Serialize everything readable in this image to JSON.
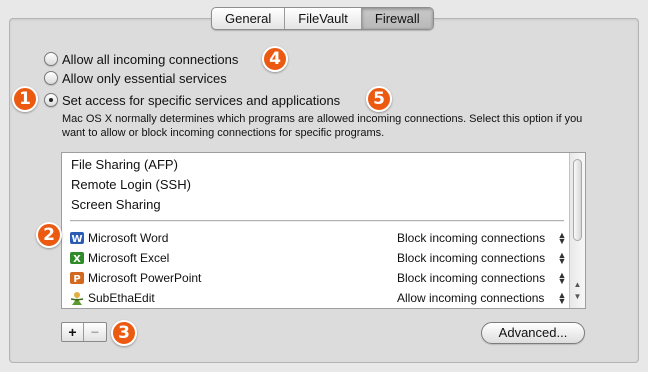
{
  "tabs": [
    {
      "label": "General",
      "selected": false
    },
    {
      "label": "FileVault",
      "selected": false
    },
    {
      "label": "Firewall",
      "selected": true
    }
  ],
  "radios": {
    "allow_all": {
      "label": "Allow all incoming connections",
      "checked": false
    },
    "essential": {
      "label": "Allow only essential services",
      "checked": false
    },
    "specific": {
      "label": "Set access for specific services and applications",
      "checked": true
    }
  },
  "description": "Mac OS X normally determines which programs are allowed incoming connections. Select this option if you want to allow or block incoming connections for specific programs.",
  "services": [
    "File Sharing (AFP)",
    "Remote Login (SSH)",
    "Screen Sharing"
  ],
  "apps": [
    {
      "name": "Microsoft Word",
      "action": "Block incoming connections",
      "icon": "microsoft-word-icon",
      "color": "#2a5bb5"
    },
    {
      "name": "Microsoft Excel",
      "action": "Block incoming connections",
      "icon": "microsoft-excel-icon",
      "color": "#2f8a2a"
    },
    {
      "name": "Microsoft PowerPoint",
      "action": "Block incoming connections",
      "icon": "microsoft-powerpoint-icon",
      "color": "#d2691e"
    },
    {
      "name": "SubEthaEdit",
      "action": "Allow incoming connections",
      "icon": "subethaedit-icon",
      "color": "#5a9a2a"
    }
  ],
  "badges": [
    "1",
    "2",
    "3",
    "4",
    "5"
  ],
  "buttons": {
    "add": "+",
    "remove": "−",
    "advanced": "Advanced..."
  },
  "colors": {
    "badge": "#ec5a12",
    "selected_tab": "#bcbcbc"
  }
}
